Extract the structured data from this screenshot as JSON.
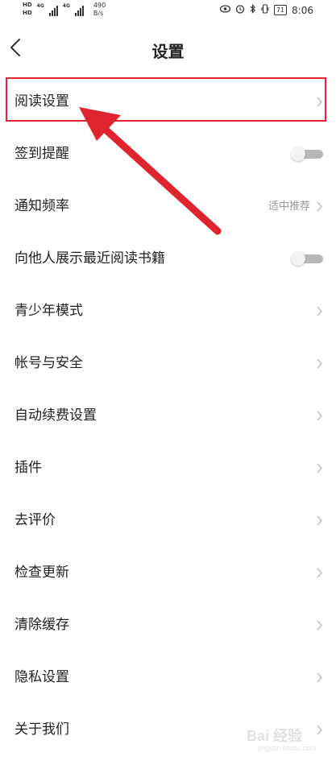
{
  "status_bar": {
    "hd_1": "HD",
    "hd_2": "HD",
    "net_1": "4G",
    "net_2": "4G",
    "speed_value": "490",
    "speed_unit": "B/s",
    "battery": "71",
    "time": "8:06"
  },
  "header": {
    "title": "设置"
  },
  "settings": {
    "items": [
      {
        "label": "阅读设置",
        "control": "chevron"
      },
      {
        "label": "签到提醒",
        "control": "toggle",
        "on": false
      },
      {
        "label": "通知频率",
        "control": "chevron",
        "value": "适中推荐"
      },
      {
        "label": "向他人展示最近阅读书籍",
        "control": "toggle",
        "on": false
      },
      {
        "label": "青少年模式",
        "control": "chevron"
      },
      {
        "label": "帐号与安全",
        "control": "chevron"
      },
      {
        "label": "自动续费设置",
        "control": "chevron"
      },
      {
        "label": "插件",
        "control": "chevron"
      },
      {
        "label": "去评价",
        "control": "chevron"
      },
      {
        "label": "检查更新",
        "control": "chevron"
      },
      {
        "label": "清除缓存",
        "control": "chevron"
      },
      {
        "label": "隐私设置",
        "control": "chevron"
      },
      {
        "label": "关于我们",
        "control": "chevron"
      }
    ]
  },
  "annotation": {
    "color": "#e0242f"
  },
  "watermark": {
    "main": "Bai 经验",
    "sub": "jingyan.baidu.com"
  },
  "icons": {
    "back": "chevron-left-icon",
    "chevron": "chevron-right-icon",
    "eye": "eye-icon",
    "alarm": "alarm-icon",
    "bluetooth": "bluetooth-icon",
    "vibrate": "vibrate-icon"
  }
}
